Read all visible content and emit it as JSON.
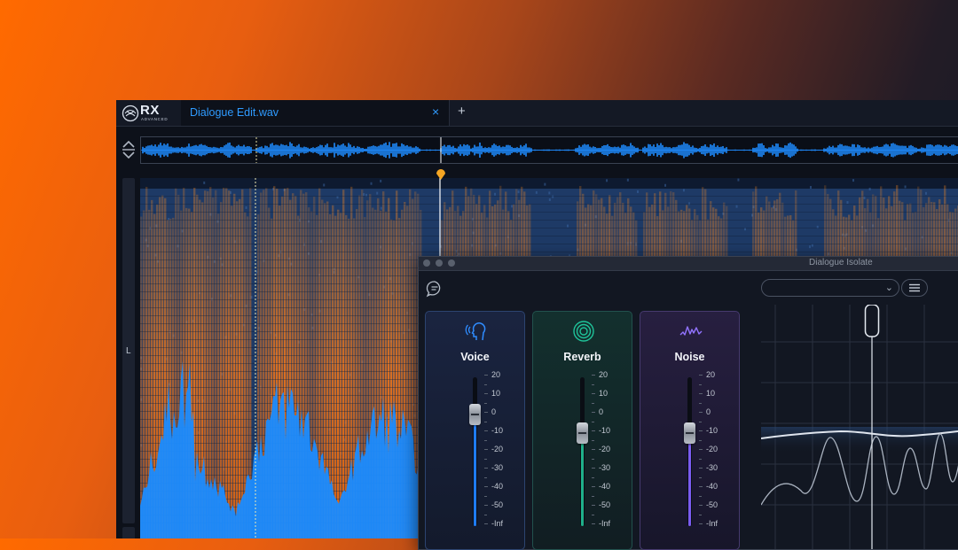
{
  "app": {
    "logo_text": "RX",
    "logo_sub": "ADVANCED",
    "tab_name": "Dialogue Edit.wav",
    "tab_close": "×",
    "new_tab": "+",
    "channel_label": "L"
  },
  "plugin": {
    "title": "Dialogue Isolate",
    "preset_value": "",
    "panels": [
      {
        "label": "Voice",
        "level_db": 0,
        "accent": "#1f7cff",
        "icon": "head-voice-icon"
      },
      {
        "label": "Reverb",
        "level_db": -10,
        "accent": "#1fb08a",
        "icon": "reverb-rings-icon"
      },
      {
        "label": "Noise",
        "level_db": -10,
        "accent": "#7a5cf0",
        "icon": "noise-wave-icon"
      }
    ],
    "scale": [
      "20",
      "10",
      "0",
      "-10",
      "-20",
      "-30",
      "-40",
      "-50",
      "-Inf"
    ]
  },
  "colors": {
    "accent_blue": "#2f9bff",
    "spectrogram_orange": "#ff7a14",
    "playhead_marker": "#f5a623"
  }
}
